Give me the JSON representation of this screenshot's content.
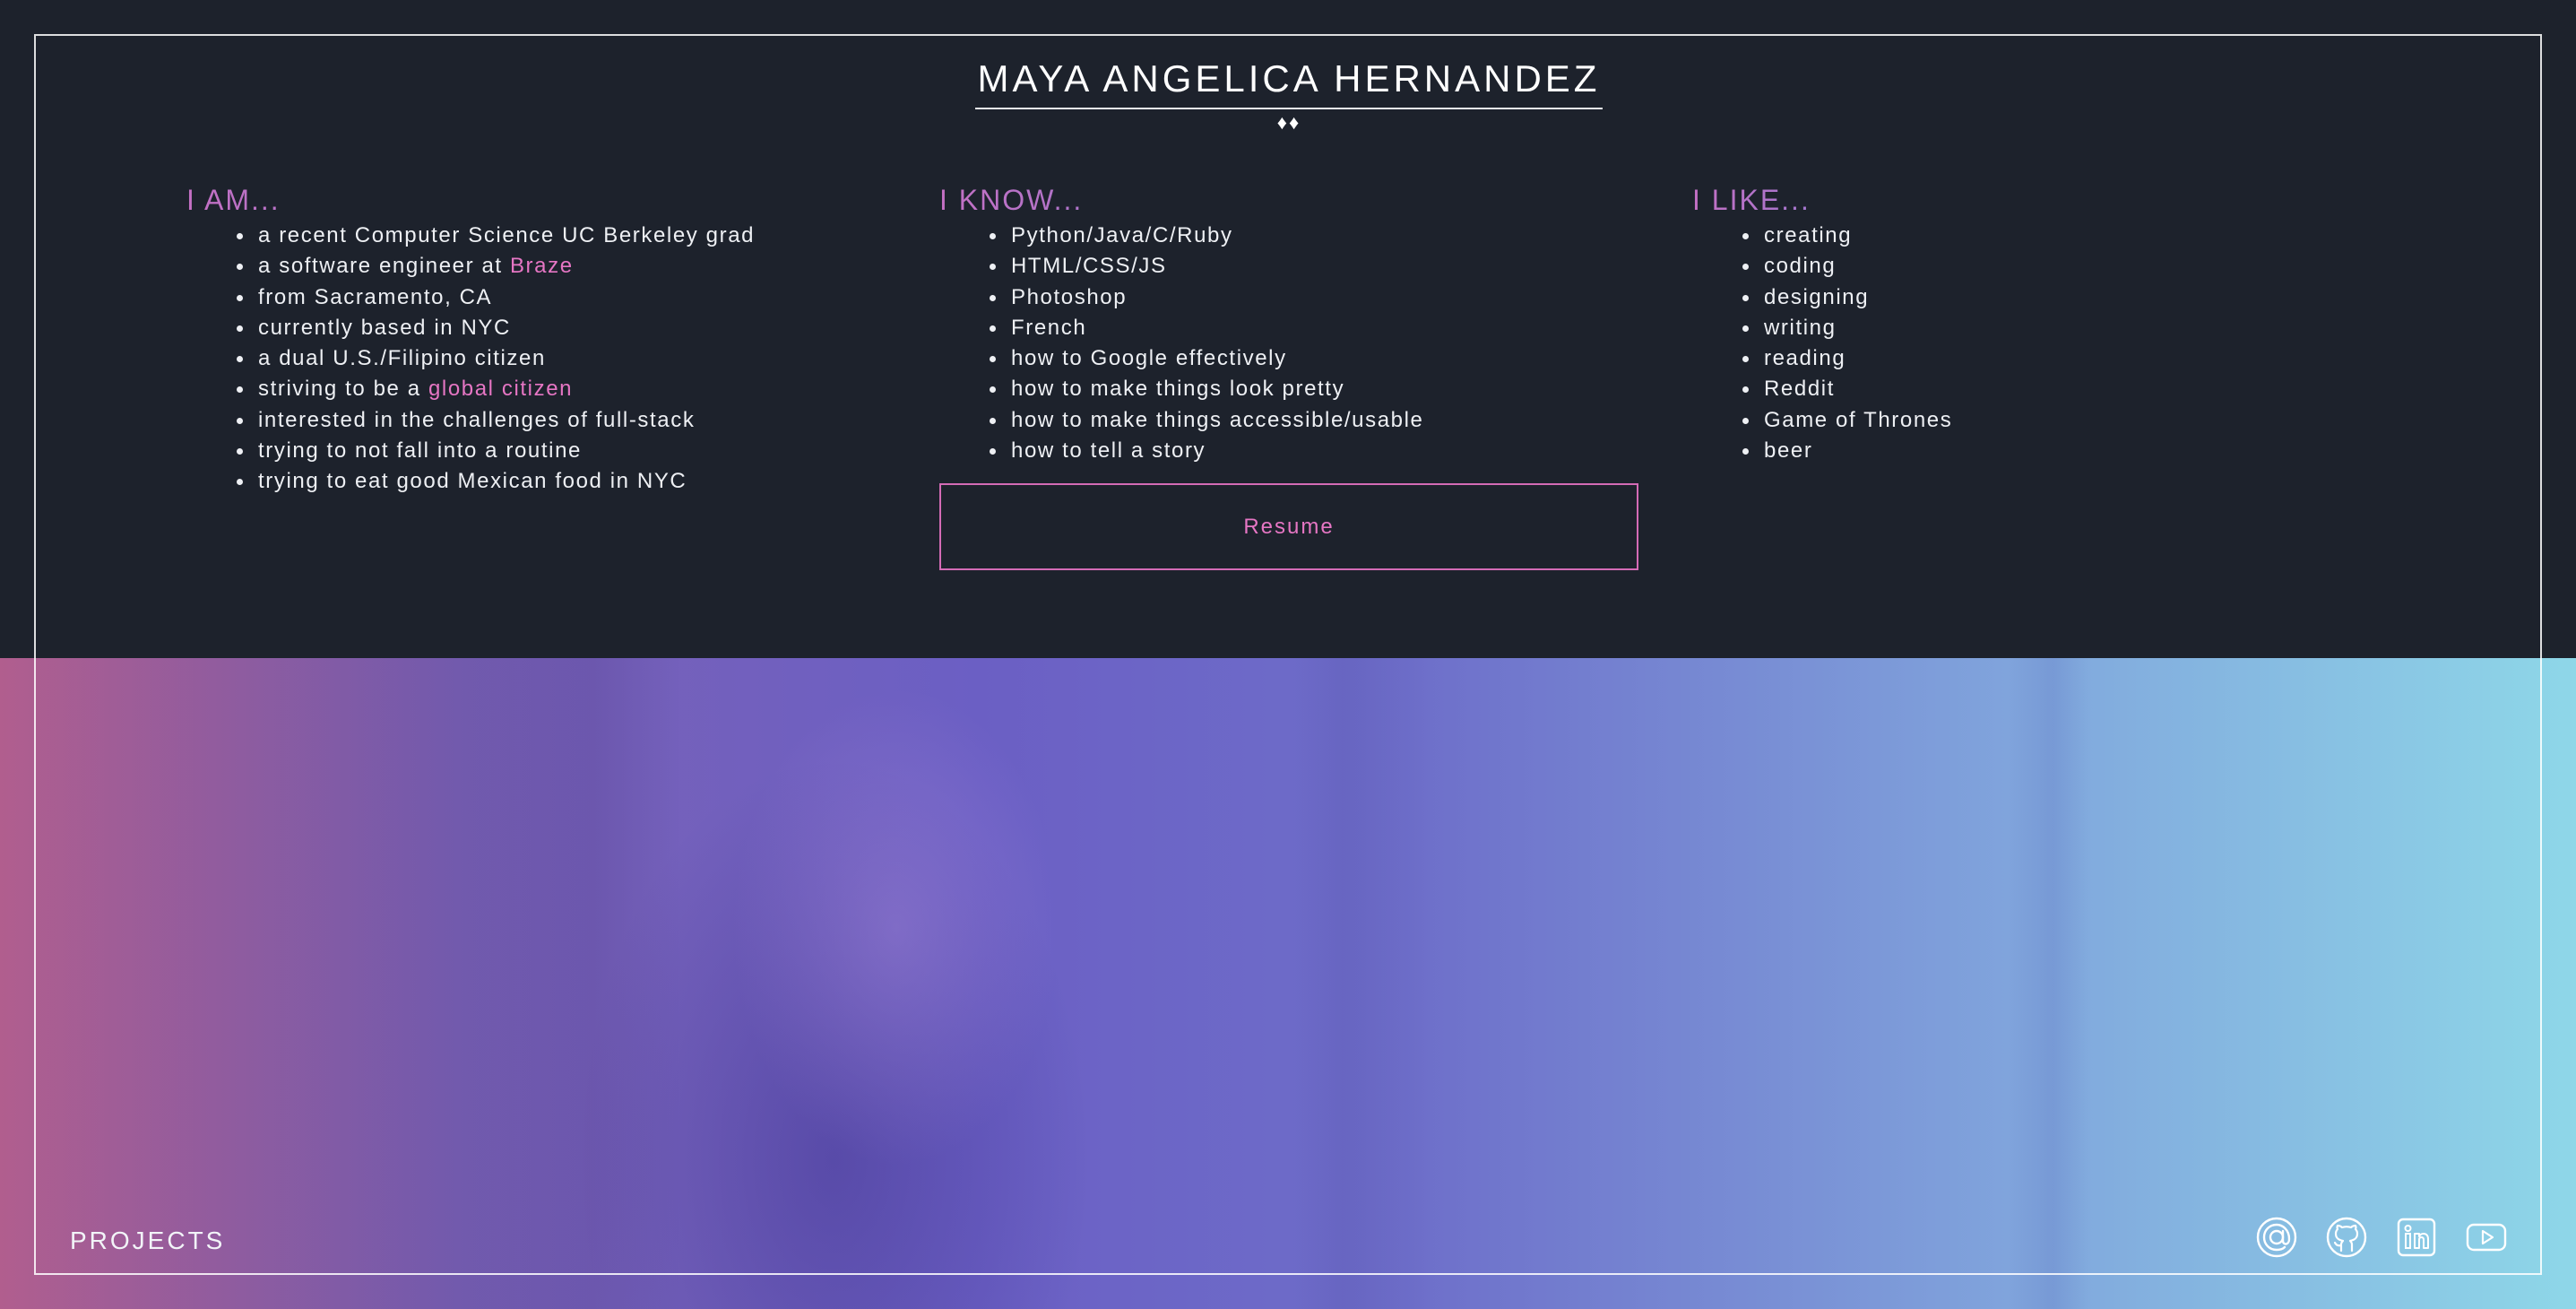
{
  "header": {
    "name": "MAYA ANGELICA HERNANDEZ",
    "ornament": "♦♦"
  },
  "columns": {
    "am": {
      "heading": "I AM...",
      "items": [
        {
          "text": "a recent Computer Science UC Berkeley grad"
        },
        {
          "text": "a software engineer at ",
          "link": "Braze"
        },
        {
          "text": "from Sacramento, CA"
        },
        {
          "text": "currently based in NYC"
        },
        {
          "text": "a dual U.S./Filipino citizen"
        },
        {
          "text": "striving to be a ",
          "link": "global citizen"
        },
        {
          "text": "interested in the challenges of full-stack"
        },
        {
          "text": "trying to not fall into a routine"
        },
        {
          "text": "trying to eat good Mexican food in NYC"
        }
      ]
    },
    "know": {
      "heading": "I KNOW...",
      "items": [
        "Python/Java/C/Ruby",
        "HTML/CSS/JS",
        "Photoshop",
        "French",
        "how to Google effectively",
        "how to make things look pretty",
        "how to make things accessible/usable",
        "how to tell a story"
      ],
      "button_label": "Resume"
    },
    "like": {
      "heading": "I LIKE...",
      "items": [
        "creating",
        "coding",
        "designing",
        "writing",
        "reading",
        "Reddit",
        "Game of Thrones",
        "beer"
      ]
    }
  },
  "footer": {
    "projects_label": "PROJECTS",
    "social_icons": [
      "email-icon",
      "github-icon",
      "linkedin-icon",
      "youtube-icon"
    ]
  },
  "colors": {
    "background": "#1d222c",
    "accent_pink": "#e676c4",
    "heading_gradient_start": "#c470c4",
    "heading_gradient_end": "#7b7ed8",
    "hero_gradient_left": "#b15e8e",
    "hero_gradient_mid": "#6b5fc4",
    "hero_gradient_right": "#8ed7e8"
  }
}
